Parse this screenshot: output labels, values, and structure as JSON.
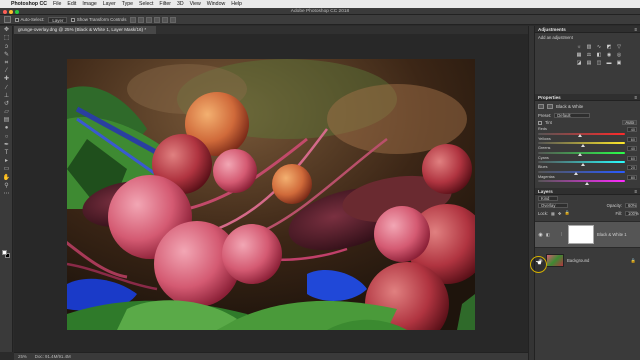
{
  "menubar": {
    "app_name": "Photoshop CC",
    "items": [
      "File",
      "Edit",
      "Image",
      "Layer",
      "Type",
      "Select",
      "Filter",
      "3D",
      "View",
      "Window",
      "Help"
    ]
  },
  "window": {
    "title": "Adobe Photoshop CC 2018"
  },
  "options_bar": {
    "auto_select_label": "Auto-Select:",
    "auto_select_value": "Layer",
    "transform_controls_label": "Show Transform Controls"
  },
  "document_tab": {
    "label": "grunge-overlay.dng @ 25% (Black & White 1, Layer Mask/16) *"
  },
  "status_bar": {
    "zoom": "25%",
    "doc_info": "Doc: 91.4M/91.4M"
  },
  "adjustments": {
    "title": "Adjustments",
    "subtitle": "Add an adjustment"
  },
  "properties": {
    "title": "Properties",
    "adjustment_name": "Black & White",
    "preset_label": "Preset:",
    "preset_value": "Default",
    "tint_label": "Tint",
    "auto_label": "Auto",
    "sliders": [
      {
        "label": "Reds",
        "value": 40,
        "gradient": "linear-gradient(90deg,#555,#ff2a2a)"
      },
      {
        "label": "Yellows",
        "value": 60,
        "gradient": "linear-gradient(90deg,#555,#ffe82a)"
      },
      {
        "label": "Greens",
        "value": 40,
        "gradient": "linear-gradient(90deg,#555,#2aff4a)"
      },
      {
        "label": "Cyans",
        "value": 60,
        "gradient": "linear-gradient(90deg,#555,#2affff)"
      },
      {
        "label": "Blues",
        "value": 20,
        "gradient": "linear-gradient(90deg,#555,#2a5aff)"
      },
      {
        "label": "Magentas",
        "value": 80,
        "gradient": "linear-gradient(90deg,#555,#ff2aff)"
      }
    ]
  },
  "layers": {
    "title": "Layers",
    "kind_label": "Kind",
    "blend_mode": "Overlay",
    "opacity_label": "Opacity:",
    "opacity_value": "60%",
    "lock_label": "Lock:",
    "fill_label": "Fill:",
    "fill_value": "100%",
    "items": [
      {
        "name": "Black & White 1"
      },
      {
        "name": "Background"
      }
    ]
  }
}
